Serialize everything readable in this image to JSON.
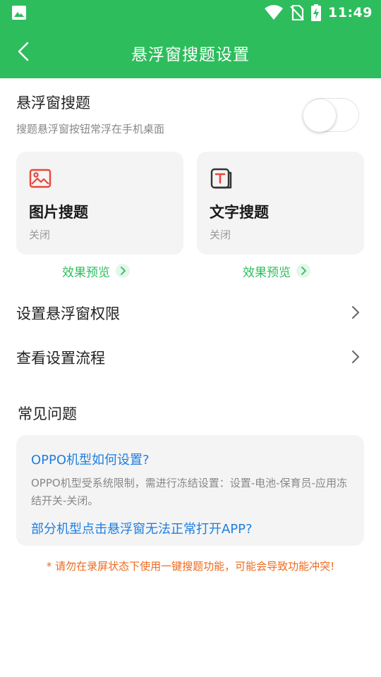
{
  "status_bar": {
    "time": "11:49",
    "icons": [
      "image-icon",
      "wifi-icon",
      "no-sim-icon",
      "battery-charging-icon"
    ]
  },
  "app_bar": {
    "title": "悬浮窗搜题设置",
    "back_icon": "back-arrow-icon"
  },
  "floating_toggle": {
    "title": "悬浮窗搜题",
    "subtitle": "搜题悬浮窗按钮常浮在手机桌面",
    "enabled": false
  },
  "cards": [
    {
      "title": "图片搜题",
      "status": "关闭",
      "icon": "image-search-icon",
      "preview_label": "效果预览"
    },
    {
      "title": "文字搜题",
      "status": "关闭",
      "icon": "text-search-icon",
      "preview_label": "效果预览"
    }
  ],
  "list_items": [
    {
      "label": "设置悬浮窗权限"
    },
    {
      "label": "查看设置流程"
    }
  ],
  "faq": {
    "heading": "常见问题",
    "q1": "OPPO机型如何设置?",
    "a1": "OPPO机型受系统限制，需进行冻结设置：设置-电池-保育员-应用冻结开关-关闭。",
    "q2": "部分机型点击悬浮窗无法正常打开APP?"
  },
  "warning": "* 请勿在录屏状态下使用一键搜题功能，可能会导致功能冲突!",
  "colors": {
    "primary": "#2dbd5c",
    "link": "#1e7fe0",
    "warning": "#ee6a1e",
    "card_icon": "#e8473b"
  }
}
